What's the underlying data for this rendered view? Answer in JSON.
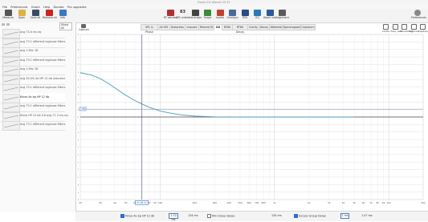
{
  "window": {
    "title": "Room EQ Wizard V5.31"
  },
  "menu": [
    "File",
    "Preferences",
    "Graph",
    "Help",
    "Donate",
    "Pro upgrades"
  ],
  "toolbar": {
    "left": [
      {
        "label": "Measure",
        "icon": "measure-icon",
        "color": "#555555"
      },
      {
        "label": "Open",
        "icon": "open-folder-icon",
        "color": "#e0b040"
      },
      {
        "label": "Save all",
        "icon": "save-icon",
        "color": "#3a4a6a"
      },
      {
        "label": "Remove all",
        "icon": "remove-icon",
        "color": "#cc2222"
      },
      {
        "label": "Info",
        "icon": "info-icon",
        "color": "#3a78c2"
      }
    ],
    "center": [
      {
        "label": "RT window",
        "icon": "rt-window-icon",
        "color": "#b03030"
      },
      {
        "label": "SPL meter",
        "icon": "spl-meter-icon",
        "color": "#333333"
      },
      {
        "label": "Generator",
        "icon": "generator-icon",
        "color": "#444444"
      },
      {
        "label": "Scope",
        "icon": "scope-icon",
        "color": "#3a8a3a"
      },
      {
        "label": "Levels",
        "icon": "levels-icon",
        "color": "#c04030"
      },
      {
        "label": "Overlays",
        "icon": "overlays-icon",
        "color": "#4a6a9a"
      },
      {
        "label": "RTA",
        "icon": "rta-icon",
        "color": "#2a4a8a"
      },
      {
        "label": "EQ",
        "icon": "eq-icon",
        "color": "#2a7ab0"
      },
      {
        "label": "Room sim",
        "icon": "room-sim-icon",
        "color": "#2a5a9a"
      },
      {
        "label": "Alignment",
        "icon": "alignment-icon",
        "color": "#5a5a5a"
      }
    ],
    "spl_readout": "83",
    "preferences_label": "Preferences"
  },
  "left_panel": {
    "show_all_label": "Show all",
    "measurements": [
      {
        "name": "avg 73.0 ms eq",
        "selected": false
      },
      {
        "name": "avg 73.1 different loglouse filters",
        "selected": false
      },
      {
        "name": "avg 1 Mar 18",
        "selected": false
      },
      {
        "name": "avg 73.1 different loglouse filters",
        "selected": false
      },
      {
        "name": "avg 1 Mar 18",
        "selected": false
      },
      {
        "name": "avg 35.0% 4e HP 12 db inducted",
        "selected": false
      },
      {
        "name": "avg 73.1 different loglouse filters",
        "selected": false
      },
      {
        "name": "Kines 4e bp HP 12 db",
        "selected": true
      },
      {
        "name": "avg 73.1 different loglouse filters",
        "selected": false
      },
      {
        "name": "Kines HP 12 db 0.6 avg 71 4 ms eq",
        "selected": false
      },
      {
        "name": "avg 73.1 different loglouse filters",
        "selected": false
      }
    ]
  },
  "graph_tabs": [
    {
      "label": "SPL & Phase",
      "active": false
    },
    {
      "label": "All SPL",
      "active": false
    },
    {
      "label": "Distortion",
      "active": false
    },
    {
      "label": "Impulse",
      "active": false
    },
    {
      "label": "Filtered IR",
      "active": false
    },
    {
      "label": "GD",
      "active": true
    },
    {
      "label": "RT60",
      "active": false
    },
    {
      "label": "RT60 Decay",
      "active": false
    },
    {
      "label": "Clarity",
      "active": false
    },
    {
      "label": "Decay",
      "active": false
    },
    {
      "label": "Waterfall",
      "active": false
    },
    {
      "label": "Spectrogram",
      "active": false
    },
    {
      "label": "Cepstrum",
      "active": false
    }
  ],
  "right_panel": {
    "buttons": [
      "Limits",
      "Freq. Axis",
      "Smoothing",
      "Controls",
      "Capture"
    ]
  },
  "capture_label": "Capture",
  "chart_data": {
    "type": "line",
    "xlabel": "",
    "ylabel": "",
    "x_scale": "log",
    "xlim": [
      20,
      20000
    ],
    "ylim": [
      -11,
      11
    ],
    "y_ticks": [
      "11",
      "10ms",
      "9",
      "8ms",
      "7",
      "6ms",
      "5",
      "4ms",
      "3",
      "2ms",
      "1",
      "0",
      "-1",
      "-2ms",
      "-3",
      "-4ms",
      "-5",
      "-6ms",
      "-7",
      "-8ms",
      "-9",
      "-10ms",
      "-11"
    ],
    "x_ticks": [
      "20",
      "30",
      "40",
      "50",
      "60",
      "70",
      "80",
      "90",
      "100",
      "200",
      "300",
      "400",
      "500",
      "600",
      "700",
      "800",
      "1k",
      "2k",
      "3k",
      "4k",
      "5k",
      "6k",
      "7k",
      "8k",
      "9k",
      "10k",
      "20k"
    ],
    "cursor_x_label": "81.88 Hz",
    "cursor_value_label": "1.88",
    "series": [
      {
        "name": "",
        "color": "#4a9cb4",
        "x": [
          20,
          25,
          30,
          35,
          40,
          50,
          60,
          70,
          80,
          100,
          120,
          150,
          200,
          300,
          500,
          1000,
          2000,
          5000
        ],
        "y": [
          5.9,
          5.6,
          5.1,
          4.5,
          3.9,
          2.9,
          2.2,
          1.7,
          1.3,
          0.8,
          0.55,
          0.3,
          0.12,
          0.02,
          0.0,
          0.0,
          0.0,
          0.0
        ]
      }
    ],
    "cursor_x": 69,
    "grid": true,
    "legend": "none"
  },
  "bottom_bar": {
    "items": [
      {
        "kind": "check",
        "checked": true,
        "label": "Kines 4e bp HP 12 db"
      },
      {
        "kind": "box",
        "value": "1.10 ms"
      },
      {
        "kind": "text",
        "value": "134 ms"
      },
      {
        "kind": "check",
        "checked": false,
        "label": "Min Group Delay"
      },
      {
        "kind": "text",
        "value": "134 ms"
      },
      {
        "kind": "check",
        "checked": true,
        "label": "Excess Group Delay"
      },
      {
        "kind": "box",
        "value": "1 ms"
      },
      {
        "kind": "text",
        "value": "1.07 ms"
      }
    ]
  }
}
